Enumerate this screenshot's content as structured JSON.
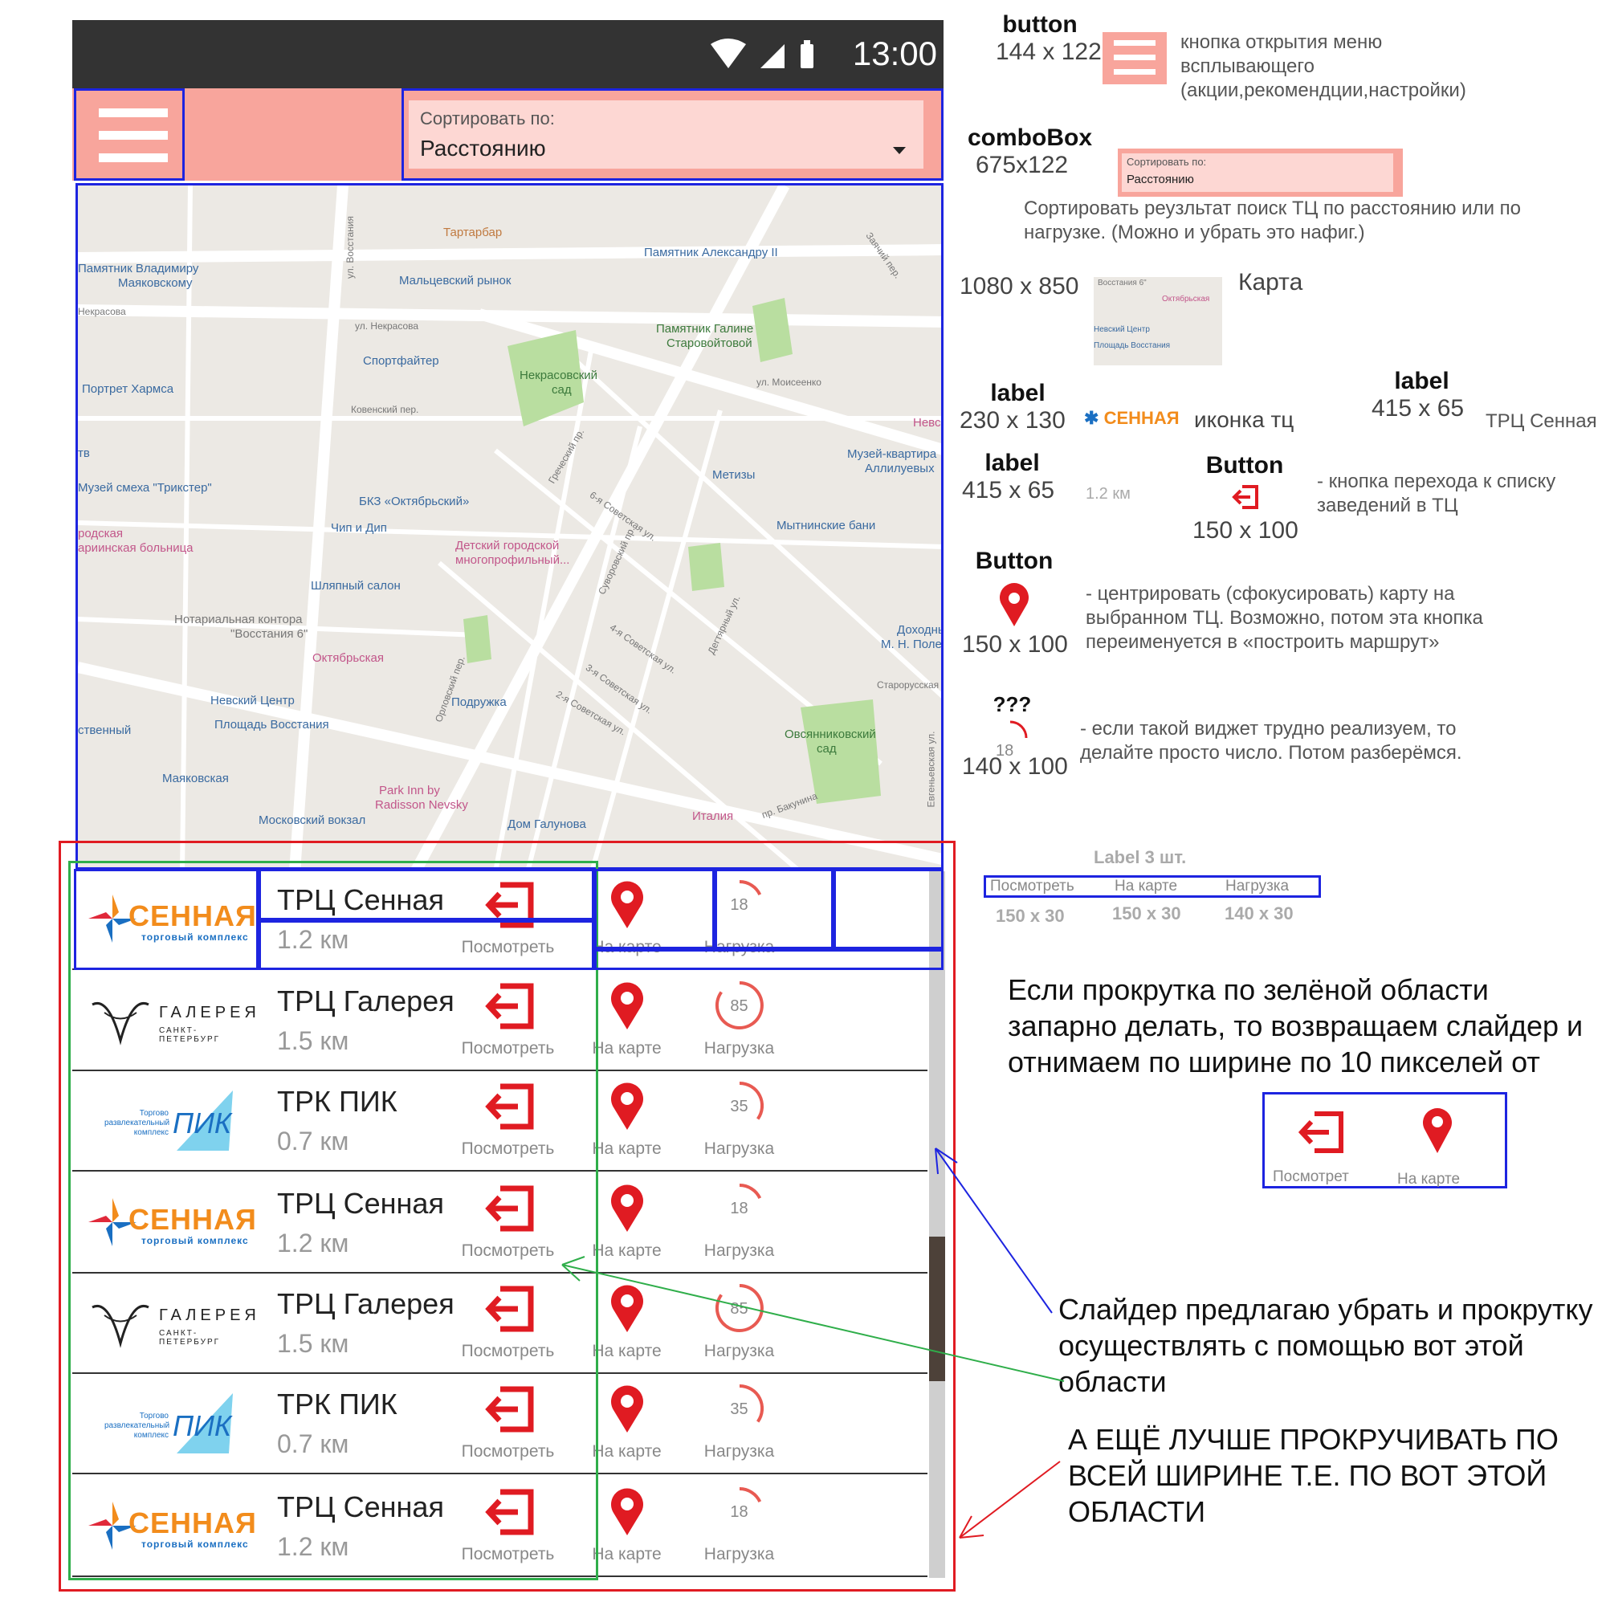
{
  "status_bar": {
    "time": "13:00"
  },
  "toolbar": {
    "sort_label": "Сортировать по:",
    "sort_value": "Расстоянию"
  },
  "map": {
    "labels": [
      "Тартарбар",
      "Памятник Александру II",
      "Памятник Владимиру",
      "Маяковскому",
      "Мальцевский рынок",
      "Некрасова",
      "ул. Некрасова",
      "Памятник Галине",
      "Старовойтовой",
      "Спортфайтер",
      "Некрасовский",
      "сад",
      "Портрет Хармса",
      "ул. Моисеенко",
      "Невс",
      "Музей-квартира",
      "Аллилуевых",
      "Метизы",
      "Музей смеха \"Трикстер\"",
      "БКЗ «Октябрьский»",
      "Мытнинские бани",
      "Чип и Дип",
      "Детский городской",
      "многопрофильный...",
      "Шляпный салон",
      "Нотариальная контора",
      "\"Восстания 6\"",
      "Доходны",
      "М. Н. Поле",
      "Октябрьская",
      "Невский Центр",
      "Площадь Восстания",
      "Подружка",
      "2-я Советская ул.",
      "Овсянниковский",
      "сад",
      "Маяковская",
      "Park Inn by",
      "Radisson Nevsky",
      "Московский вокзал",
      "Дом Галунова",
      "Италия",
      "пр. Бакунина",
      "ул. Восстания",
      "Суворовский пр.",
      "Старорусская",
      "Евгеньевская ул.",
      "родская",
      "ариинская больница",
      "ственный",
      "тв",
      "Ковенский пер.",
      "Греческий пр.",
      "6-я Советская ул.",
      "4-я Советская ул.",
      "3-я Советская ул.",
      "Дегтярный ул.",
      "Заячий пер.",
      "Орловский пер."
    ]
  },
  "actions": {
    "view": "Посмотреть",
    "map": "На карте",
    "load": "Нагрузка"
  },
  "items": [
    {
      "name": "ТРЦ Сенная",
      "distance": "1.2 км",
      "load": "18",
      "logo": "СЕННАЯ",
      "logo_sub": "торговый комплекс"
    },
    {
      "name": "ТРЦ Галерея",
      "distance": "1.5 км",
      "load": "85",
      "logo": "ГАЛЕРЕЯ",
      "logo_sub": "САНКТ-ПЕТЕРБУРГ"
    },
    {
      "name": "ТРК ПИК",
      "distance": "0.7 км",
      "load": "35",
      "logo": "ПИК",
      "logo_sub": "Торгово развлекательный комплекс"
    },
    {
      "name": "ТРЦ Сенная",
      "distance": "1.2 км",
      "load": "18",
      "logo": "СЕННАЯ",
      "logo_sub": "торговый комплекс"
    },
    {
      "name": "ТРЦ Галерея",
      "distance": "1.5 км",
      "load": "85",
      "logo": "ГАЛЕРЕЯ",
      "logo_sub": "САНКТ-ПЕТЕРБУРГ"
    },
    {
      "name": "ТРК ПИК",
      "distance": "0.7 км",
      "load": "35",
      "logo": "ПИК",
      "logo_sub": "Торгово развлекательный комплекс"
    },
    {
      "name": "ТРЦ Сенная",
      "distance": "1.2 км",
      "load": "18",
      "logo": "СЕННАЯ",
      "logo_sub": "торговый комплекс"
    }
  ],
  "annotations": {
    "button": {
      "title": "button",
      "size": "144 x 122",
      "desc": "кнопка открытия меню всплывающего (акции,рекомендции,настройки)"
    },
    "combobox": {
      "title": "comboBox",
      "size": "675x122",
      "mini_label": "Сортировать по:",
      "mini_value": "Расстоянию",
      "desc": "Сортировать реузльтат поиск ТЦ по расстоянию или по нагрузке. (Можно и убрать это нафиг.)"
    },
    "map": {
      "size": "1080 x 850",
      "title": "Карта",
      "mini1": "Восстания 6\"",
      "mini2": "Октябрьская",
      "mini3": "Невский Центр",
      "mini4": "Площадь Восстания"
    },
    "label_icon": {
      "title": "label",
      "size": "230 x 130",
      "logo": "СЕННАЯ",
      "desc": "иконка тц"
    },
    "label_name": {
      "title": "label",
      "size": "415 x 65",
      "desc": "ТРЦ Сенная"
    },
    "label_dist": {
      "title": "label",
      "size": "415 x 65",
      "desc": "1.2 км"
    },
    "button_go": {
      "title": "Button",
      "size": "150 x 100",
      "desc": "- кнопка перехода к списку заведений в ТЦ"
    },
    "button_pin": {
      "title": "Button",
      "size": "150 x 100",
      "desc": "- центрировать (сфокусировать) карту на выбранном ТЦ. Возможно, потом эта кнопка переименуется в «построить маршрут»"
    },
    "gauge": {
      "title": "???",
      "value": "18",
      "size": "140 x 100",
      "desc": "- если такой виджет трудно реализуем, то делайте просто число. Потом разберёмся."
    },
    "labels3": {
      "title": "Label 3 шт.",
      "l1": "Посмотреть",
      "l2": "На карте",
      "l3": "Нагрузка",
      "s1": "150 x 30",
      "s2": "150 x 30",
      "s3": "140 x 30"
    },
    "note1": "Если прокрутка по зелёной области запарно делать, то возвращаем слайдер и отнимаем по ширине по 10 пикселей от",
    "mini_actions": {
      "l1": "Посмотрет",
      "l2": "На карте"
    },
    "note2": "Слайдер предлагаю убрать и прокрутку осуществлять с помощью вот этой области",
    "note3": "А ЕЩЁ ЛУЧШЕ ПРОКРУЧИВАТЬ ПО ВСЕЙ ШИРИНЕ Т.Е. ПО ВОТ ЭТОЙ ОБЛАСТИ"
  },
  "colors": {
    "accent": "#e01b22",
    "appbar": "#f8a59c",
    "combo_bg": "#fdd7d3",
    "outline_blue": "#1d24e0",
    "outline_green": "#2fae4a",
    "senna_orange": "#f28c1c"
  }
}
